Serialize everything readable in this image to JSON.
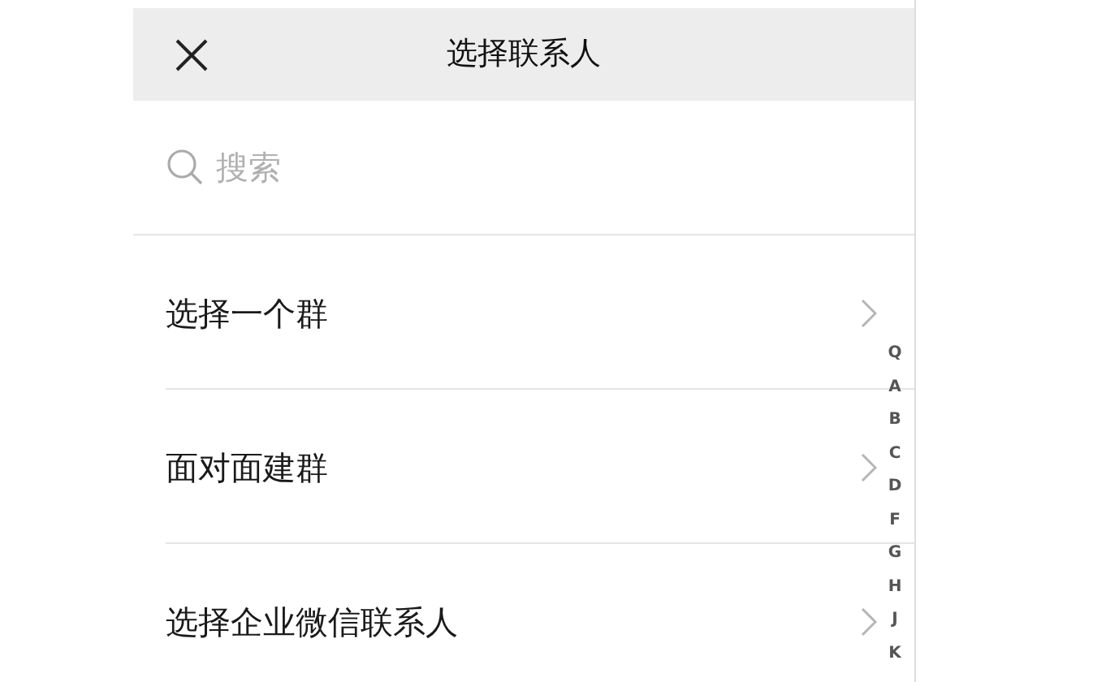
{
  "header": {
    "title": "选择联系人"
  },
  "search": {
    "placeholder": "搜索"
  },
  "items": [
    {
      "label": "选择一个群"
    },
    {
      "label": "面对面建群"
    },
    {
      "label": "选择企业微信联系人"
    }
  ],
  "index_bar": [
    "Q",
    "A",
    "B",
    "C",
    "D",
    "F",
    "G",
    "H",
    "J",
    "K"
  ]
}
